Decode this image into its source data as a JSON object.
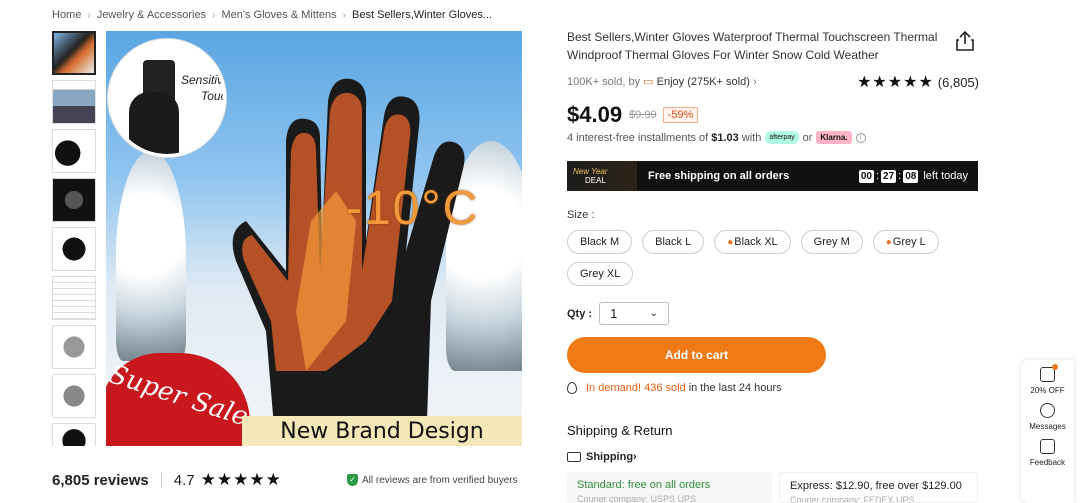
{
  "breadcrumb": [
    "Home",
    "Jewelry & Accessories",
    "Men's Gloves & Mittens",
    "Best Sellers,Winter Gloves..."
  ],
  "gallery": {
    "inset_text_1": "Sensitive",
    "inset_text_2": "Touch",
    "temperature": "-10°C",
    "promo_text": "Super Sales",
    "banner_text": "New Brand Design"
  },
  "reviews": {
    "count": "6,805 reviews",
    "rating": "4.7",
    "stars": "★★★★★",
    "verified": "All reviews are from verified buyers"
  },
  "product": {
    "title": "Best Sellers,Winter Gloves Waterproof Thermal Touchscreen Thermal Windproof Thermal Gloves For Winter Snow Cold Weather",
    "sold": "100K+ sold, by",
    "store": "Enjoy (275K+ sold)",
    "rating_count": "(6,805)",
    "price": "$4.09",
    "original_price": "$9.99",
    "discount": "-59%",
    "installments_prefix": "4 interest-free installments of",
    "installment_amount": "$1.03",
    "installments_with": "with",
    "installments_or": "or",
    "afterpay": "afterpay",
    "klarna": "Klarna."
  },
  "deal": {
    "logo_line1": "New Year",
    "logo_line2": "DEAL",
    "text": "Free shipping on all orders",
    "hours": "00",
    "minutes": "27",
    "seconds": "08",
    "suffix": "left today"
  },
  "size": {
    "label": "Size :",
    "options": [
      "Black M",
      "Black L",
      "Black XL",
      "Grey M",
      "Grey L",
      "Grey XL"
    ]
  },
  "qty": {
    "label": "Qty :",
    "value": "1"
  },
  "add_to_cart": "Add to cart",
  "demand": {
    "hot": "In demand! 436 sold",
    "rest": "in the last 24 hours"
  },
  "shipping": {
    "title": "Shipping & Return",
    "link": "Shipping",
    "standard": "Standard: free on all orders",
    "standard_sub": "Courier company:  USPS  UPS",
    "express": "Express: $12.90, free over $129.00",
    "express_sub": "Courier company:  FEDEX  UPS"
  },
  "side": {
    "coupon": "20% OFF",
    "messages": "Messages",
    "feedback": "Feedback"
  }
}
